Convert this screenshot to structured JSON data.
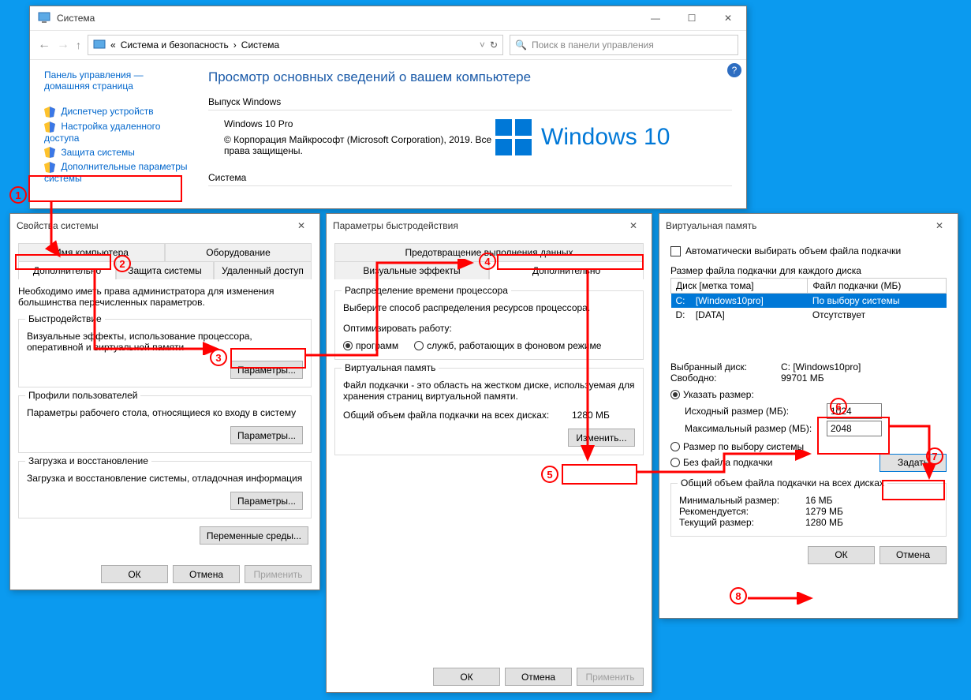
{
  "system_window": {
    "title": "Система",
    "breadcrumb_prefix": "«",
    "breadcrumb1": "Система и безопасность",
    "breadcrumb2": "Система",
    "search_placeholder": "Поиск в панели управления",
    "sidebar": {
      "home1": "Панель управления —",
      "home2": "домашняя страница",
      "items": [
        "Диспетчер устройств",
        "Настройка удаленного доступа",
        "Защита системы",
        "Дополнительные параметры системы"
      ]
    },
    "main": {
      "heading": "Просмотр основных сведений о вашем компьютере",
      "edition_label": "Выпуск Windows",
      "edition": "Windows 10 Pro",
      "copyright": "© Корпорация Майкрософт (Microsoft Corporation), 2019. Все права защищены.",
      "logo_text": "Windows 10",
      "system_label": "Система"
    }
  },
  "sysprops": {
    "title": "Свойства системы",
    "tabs_top": [
      "Имя компьютера",
      "Оборудование"
    ],
    "tabs_bottom": [
      "Дополнительно",
      "Защита системы",
      "Удаленный доступ"
    ],
    "admin_note": "Необходимо иметь права администратора для изменения большинства перечисленных параметров.",
    "perf": {
      "title": "Быстродействие",
      "desc": "Визуальные эффекты, использование процессора, оперативной и виртуальной памяти",
      "btn": "Параметры..."
    },
    "profiles": {
      "title": "Профили пользователей",
      "desc": "Параметры рабочего стола, относящиеся ко входу в систему",
      "btn": "Параметры..."
    },
    "startup": {
      "title": "Загрузка и восстановление",
      "desc": "Загрузка и восстановление системы, отладочная информация",
      "btn": "Параметры..."
    },
    "env_btn": "Переменные среды...",
    "ok": "ОК",
    "cancel": "Отмена",
    "apply": "Применить"
  },
  "perfopts": {
    "title": "Параметры быстродействия",
    "tabs": [
      "Визуальные эффекты",
      "Дополнительно",
      "Предотвращение выполнения данных"
    ],
    "sched": {
      "title": "Распределение времени процессора",
      "desc": "Выберите способ распределения ресурсов процессора.",
      "opt_label": "Оптимизировать работу:",
      "r1": "программ",
      "r2": "служб, работающих в фоновом режиме"
    },
    "vmem": {
      "title": "Виртуальная память",
      "desc": "Файл подкачки - это область на жестком диске, используемая для хранения страниц виртуальной памяти.",
      "total_label": "Общий объем файла подкачки на всех дисках:",
      "total_value": "1280 МБ",
      "btn": "Изменить..."
    },
    "ok": "ОК",
    "cancel": "Отмена",
    "apply": "Применить"
  },
  "vmem": {
    "title": "Виртуальная память",
    "auto": "Автоматически выбирать объем файла подкачки",
    "size_label": "Размер файла подкачки для каждого диска",
    "col1": "Диск [метка тома]",
    "col2": "Файл подкачки (МБ)",
    "rows": [
      {
        "drive": "C:",
        "label": "[Windows10pro]",
        "pf": "По выбору системы"
      },
      {
        "drive": "D:",
        "label": "[DATA]",
        "pf": "Отсутствует"
      }
    ],
    "sel_label": "Выбранный диск:",
    "sel_value": "C: [Windows10pro]",
    "free_label": "Свободно:",
    "free_value": "99701 МБ",
    "custom": "Указать размер:",
    "init_label": "Исходный размер (МБ):",
    "init_value": "1024",
    "max_label": "Максимальный размер (МБ):",
    "max_value": "2048",
    "sys": "Размер по выбору системы",
    "none": "Без файла подкачки",
    "set": "Задать",
    "totals_title": "Общий объем файла подкачки на всех дисках",
    "min_label": "Минимальный размер:",
    "min_value": "16 МБ",
    "rec_label": "Рекомендуется:",
    "rec_value": "1279 МБ",
    "cur_label": "Текущий размер:",
    "cur_value": "1280 МБ",
    "ok": "ОК",
    "cancel": "Отмена"
  }
}
